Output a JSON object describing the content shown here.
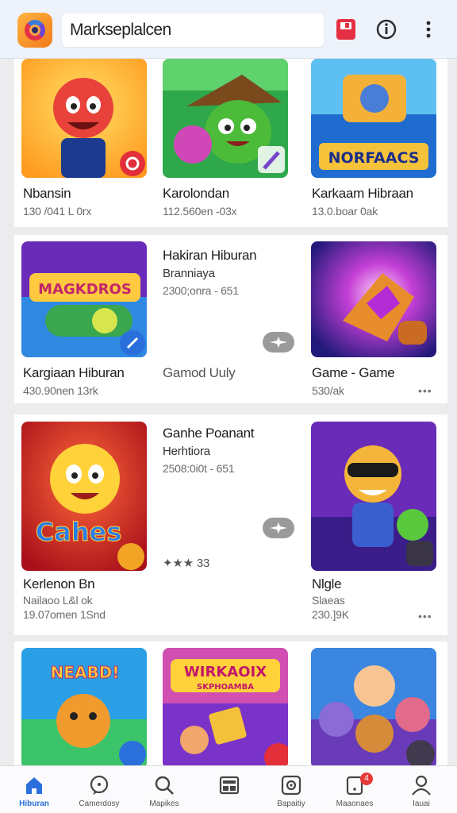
{
  "header": {
    "search_value": "Markseplalcen",
    "icons": [
      "app-logo-icon",
      "bookmark-save-icon",
      "info-icon",
      "more-vertical-icon"
    ]
  },
  "rows": [
    {
      "items": [
        {
          "title": "Nbansin",
          "sub": "130 /041 L 0rx"
        },
        {
          "title": "Karolondan",
          "sub": "112.560en -03x"
        },
        {
          "title": "Karkaam Hibraan",
          "sub": "13.0.boar 0ak",
          "art_text": "NORFAACS"
        }
      ]
    },
    {
      "items": [
        {
          "title": "Kargiaan Hiburan",
          "sub": "430.90nen 13rk",
          "art_text": "MAGKDROS"
        },
        {
          "title": "Hakiran Hiburan",
          "sub": "Branniaya",
          "sub2": "2300;onra - 651",
          "extra": "Gamod Uuly"
        },
        {
          "title": "Game - Game",
          "sub": "530/ak",
          "more": "•••"
        }
      ]
    },
    {
      "items": [
        {
          "title": "Kerlenon Bn",
          "sub": "Nailaoo L&l ok",
          "sub2": "19.07omen 1Snd",
          "art_text": "Cahes"
        },
        {
          "title": "Ganhe Poanant",
          "sub": "Herhtiora",
          "sub2": "2508:0i0t - 651",
          "extra": "✦★★ 33"
        },
        {
          "title": "Nlgle",
          "sub": "Slaeas",
          "sub2": "230.]9K",
          "more": "•••"
        }
      ]
    },
    {
      "items": [
        {
          "art_text": "NEABD!"
        },
        {
          "art_text": "WIRKAOIX",
          "art_text2": "SKPHOAMBA"
        },
        {
          "art_text": ""
        }
      ]
    }
  ],
  "bottom_nav": [
    {
      "label": "Hiburan",
      "icon": "home-icon",
      "active": true
    },
    {
      "label": "Camerdosy",
      "icon": "chat-bubble-icon"
    },
    {
      "label": "Mapikes",
      "icon": "search-icon"
    },
    {
      "label": "",
      "icon": "grid-card-icon"
    },
    {
      "label": "Bapaitiy",
      "icon": "gear-box-icon"
    },
    {
      "label": "Maaonaes",
      "icon": "notification-box-icon",
      "badge": "4"
    },
    {
      "label": "Iauai",
      "icon": "profile-icon"
    }
  ],
  "colors": {
    "accent": "#2a6fdb",
    "badge": "#e53935",
    "save": "#e53044"
  }
}
